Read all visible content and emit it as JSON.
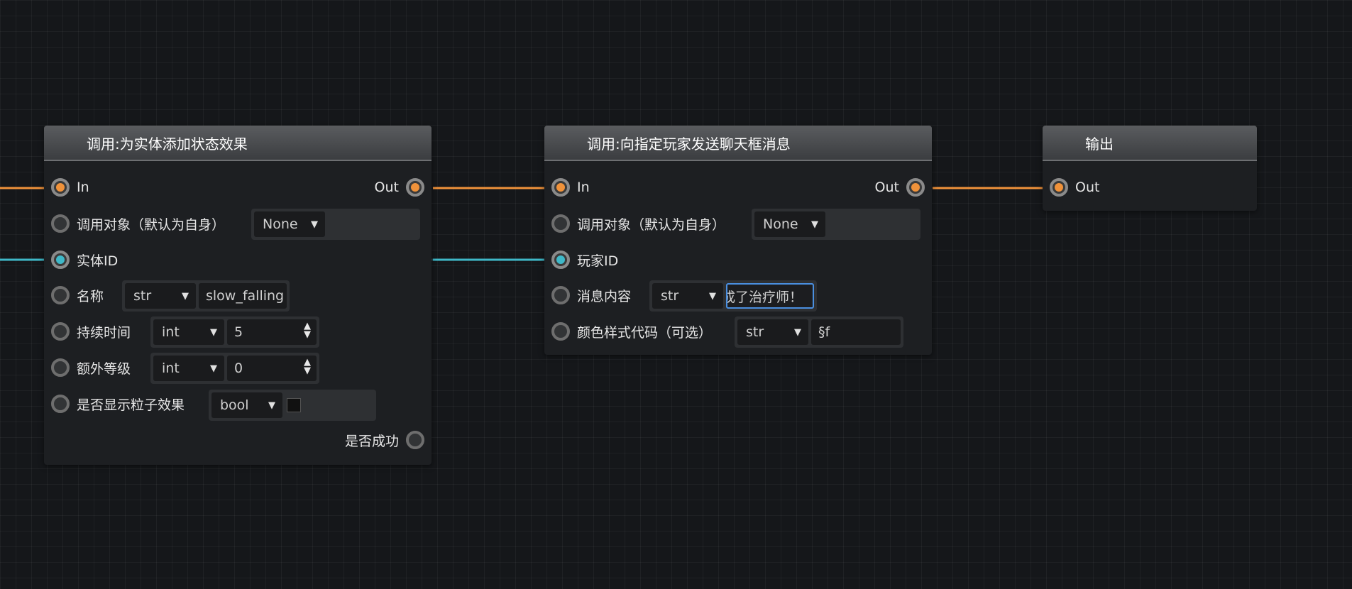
{
  "nodes": {
    "add_effect": {
      "title": "调用:为实体添加状态效果",
      "in_label": "In",
      "out_label": "Out",
      "target_label": "调用对象（默认为自身）",
      "target_value": "None",
      "entity_label": "实体ID",
      "name_label": "名称",
      "name_type": "str",
      "name_value": "slow_falling",
      "duration_label": "持续时间",
      "duration_type": "int",
      "duration_value": "5",
      "level_label": "额外等级",
      "level_type": "int",
      "level_value": "0",
      "particles_label": "是否显示粒子效果",
      "particles_type": "bool",
      "success_label": "是否成功"
    },
    "send_chat": {
      "title": "调用:向指定玩家发送聊天框消息",
      "in_label": "In",
      "out_label": "Out",
      "target_label": "调用对象（默认为自身）",
      "target_value": "None",
      "player_label": "玩家ID",
      "message_label": "消息内容",
      "message_type": "str",
      "message_value": "成了治疗师！",
      "color_label": "颜色样式代码（可选）",
      "color_type": "str",
      "color_value": "§f"
    },
    "output": {
      "title": "输出",
      "out_label": "Out"
    }
  },
  "colors": {
    "exec_wire": "#f0923a",
    "data_wire": "#3fb8c8",
    "focus_border": "#4a8fe0"
  }
}
